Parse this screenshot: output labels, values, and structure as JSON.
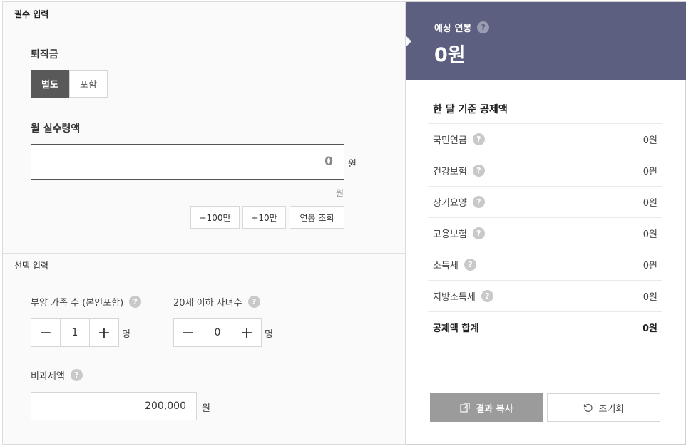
{
  "required_section": {
    "title": "필수 입력",
    "severance": {
      "label": "퇴직금",
      "options": [
        "별도",
        "포함"
      ],
      "selected": "별도"
    },
    "salary": {
      "label": "월 실수령액",
      "value": "0",
      "unit": "원",
      "hint": "원"
    },
    "quick_buttons": [
      "+100만",
      "+10만",
      "연봉 조회"
    ]
  },
  "optional_section": {
    "title": "선택 입력",
    "dependents": {
      "label": "부양 가족 수 (본인포함)",
      "value": "1",
      "unit": "명"
    },
    "children": {
      "label": "20세 이하 자녀수",
      "value": "0",
      "unit": "명"
    },
    "non_taxable": {
      "label": "비과세액",
      "value": "200,000",
      "unit": "원"
    }
  },
  "result": {
    "title": "예상 연봉",
    "amount": "0원",
    "deduction_title": "한 달 기준 공제액",
    "rows": [
      {
        "name": "국민연금",
        "value": "0원"
      },
      {
        "name": "건강보험",
        "value": "0원"
      },
      {
        "name": "장기요양",
        "value": "0원"
      },
      {
        "name": "고용보험",
        "value": "0원"
      },
      {
        "name": "소득세",
        "value": "0원"
      },
      {
        "name": "지방소득세",
        "value": "0원"
      }
    ],
    "total": {
      "name": "공제액 합계",
      "value": "0원"
    },
    "copy_label": "결과 복사",
    "reset_label": "초기화"
  },
  "icons": {
    "help": "question-circle-icon",
    "minus": "minus-icon",
    "plus": "plus-icon",
    "copy": "copy-icon",
    "reset": "reset-icon"
  },
  "colors": {
    "header_bg": "#5d5f80",
    "active_toggle": "#595959",
    "copy_button": "#9b9b9b"
  }
}
